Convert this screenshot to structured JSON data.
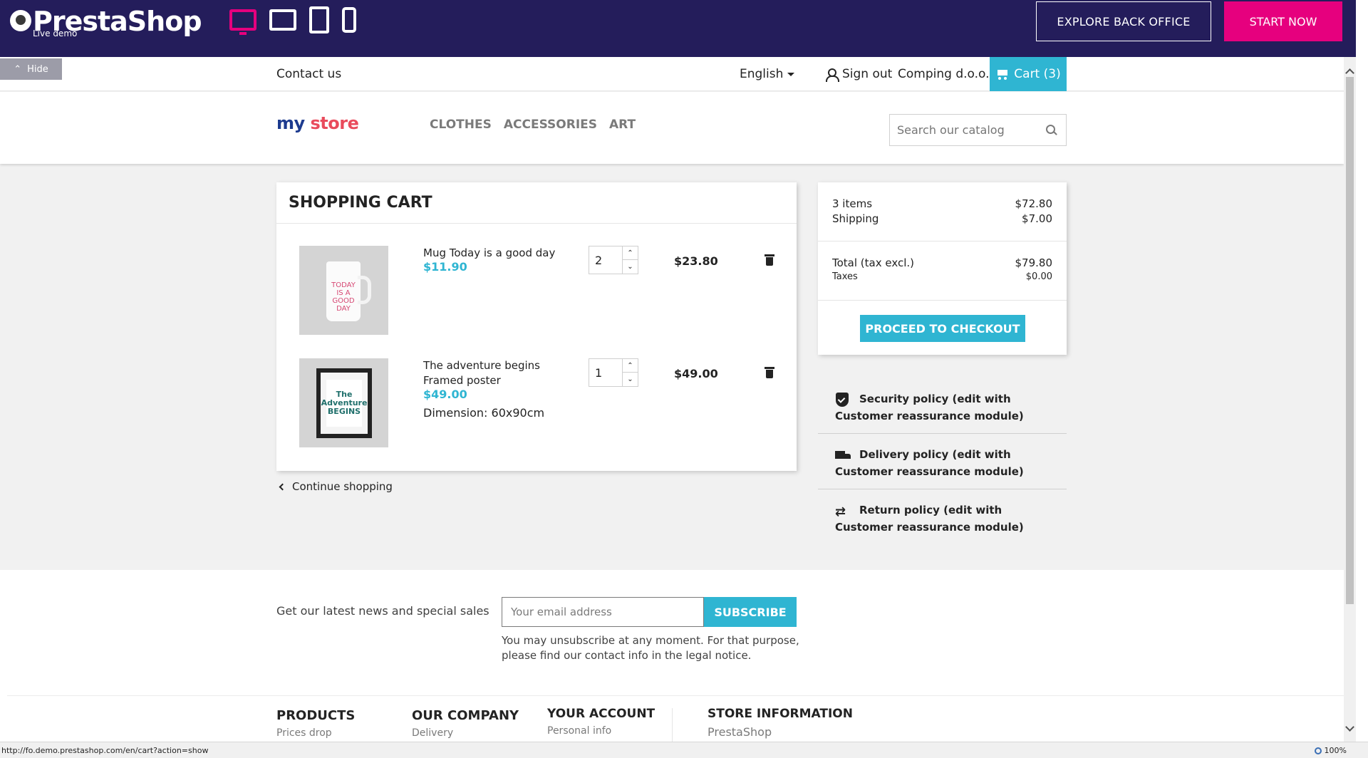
{
  "demobar": {
    "logo_text": "PrestaShop",
    "logo_sub": "Live demo",
    "devices": [
      "desktop-icon",
      "tablet-landscape-icon",
      "tablet-portrait-icon",
      "mobile-icon"
    ],
    "explore_label": "EXPLORE BACK OFFICE",
    "start_label": "START NOW",
    "accent_color": "#e6007e",
    "bar_color": "#241d5b"
  },
  "hide_label": "Hide",
  "topnav": {
    "contact": "Contact us",
    "language": "English",
    "signout": "Sign out",
    "company": "Comping d.o.o.",
    "cart": "Cart (3)"
  },
  "header": {
    "logo_my": "my",
    "logo_store": "store",
    "menu": [
      "CLOTHES",
      "ACCESSORIES",
      "ART"
    ],
    "search_placeholder": "Search our catalog"
  },
  "cart": {
    "title": "SHOPPING CART",
    "items": [
      {
        "name": "Mug Today is a good day",
        "price": "$11.90",
        "quantity": "2",
        "total": "$23.80",
        "image_text": "TODAY IS A GOOD DAY"
      },
      {
        "name": "The adventure begins Framed poster",
        "price": "$49.00",
        "attr_label": "Dimension:",
        "attr_value": "60x90cm",
        "quantity": "1",
        "total": "$49.00",
        "image_text": "The Adventure BEGINS"
      }
    ],
    "continue": "Continue shopping",
    "accent_color": "#2fb5d2"
  },
  "summary": {
    "items_label": "3 items",
    "items_value": "$72.80",
    "shipping_label": "Shipping",
    "shipping_value": "$7.00",
    "total_label": "Total (tax excl.)",
    "total_value": "$79.80",
    "taxes_label": "Taxes",
    "taxes_value": "$0.00",
    "checkout": "PROCEED TO CHECKOUT"
  },
  "reassurance": [
    {
      "icon": "shield-icon",
      "text": "Security policy (edit with Customer reassurance module)"
    },
    {
      "icon": "truck-icon",
      "text": "Delivery policy (edit with Customer reassurance module)"
    },
    {
      "icon": "swap-icon",
      "text": "Return policy (edit with Customer reassurance module)"
    }
  ],
  "newsletter": {
    "text": "Get our latest news and special sales",
    "placeholder": "Your email address",
    "button": "SUBSCRIBE",
    "note": "You may unsubscribe at any moment. For that purpose, please find our contact info in the legal notice."
  },
  "footer": {
    "col1_title": "PRODUCTS",
    "col1_link": "Prices drop",
    "col2_title": "OUR COMPANY",
    "col2_link": "Delivery",
    "col3_title": "YOUR ACCOUNT",
    "col3_link": "Personal info",
    "col4_title": "STORE INFORMATION",
    "col4_link": "PrestaShop"
  },
  "statusbar": {
    "url": "http://fo.demo.prestashop.com/en/cart?action=show",
    "zoom": "100%"
  }
}
